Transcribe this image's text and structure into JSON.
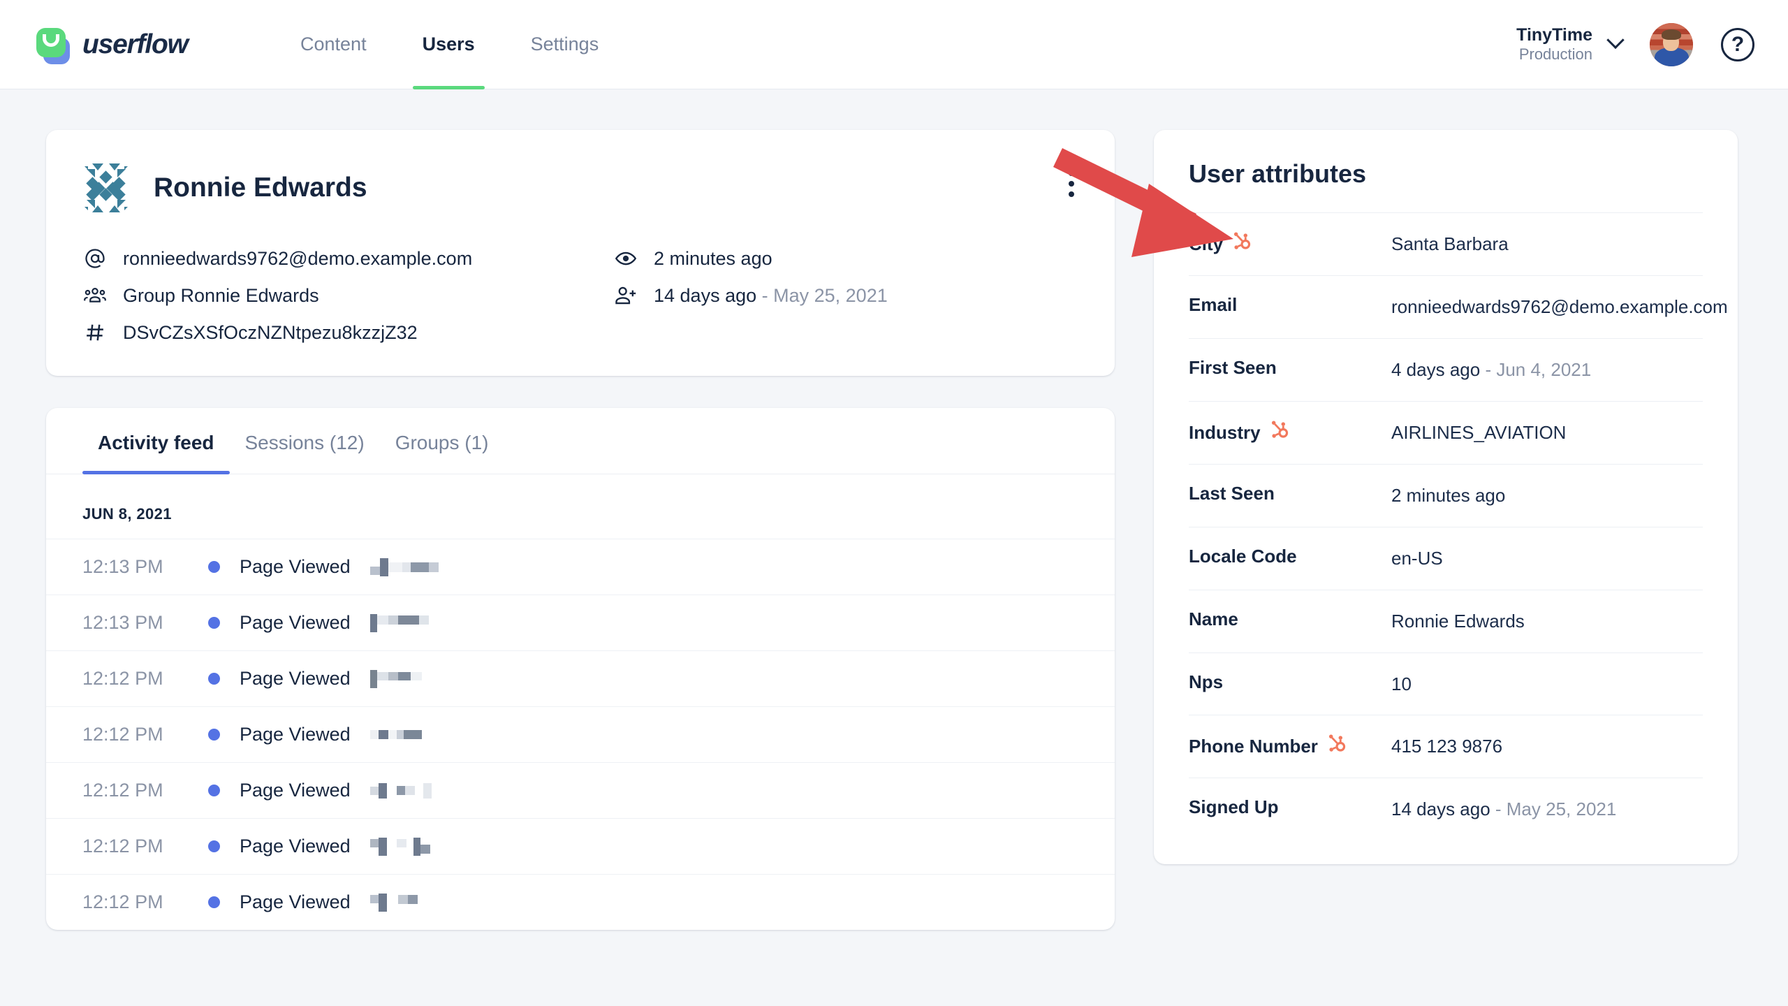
{
  "brand": {
    "wordmark": "userflow",
    "logo_icon": "userflow-logo-icon"
  },
  "nav": {
    "items": [
      {
        "label": "Content",
        "active": false
      },
      {
        "label": "Users",
        "active": true
      },
      {
        "label": "Settings",
        "active": false
      }
    ]
  },
  "header": {
    "org_name": "TinyTime",
    "org_env": "Production",
    "chevron_icon": "chevron-down-icon",
    "avatar_icon": "user-avatar",
    "help_label": "?",
    "help_icon": "help-circle-icon"
  },
  "profile": {
    "avatar_icon": "identicon-avatar",
    "name": "Ronnie Edwards",
    "menu_icon": "kebab-menu-icon",
    "rows": [
      {
        "icon": "at-sign-icon",
        "text": "ronnieedwards9762@demo.example.com",
        "suffix": ""
      },
      {
        "icon": "users-group-icon",
        "text": "Group Ronnie Edwards",
        "suffix": ""
      },
      {
        "icon": "hash-icon",
        "text": "DSvCZsXSfOczNZNtpezu8kzzjZ32",
        "suffix": ""
      },
      {
        "icon": "eye-icon",
        "text": "2 minutes ago",
        "suffix": ""
      },
      {
        "icon": "user-plus-icon",
        "text": "14 days ago",
        "suffix": " - May 25, 2021"
      }
    ]
  },
  "feed": {
    "tabs": [
      {
        "label": "Activity feed",
        "active": true
      },
      {
        "label": "Sessions (12)",
        "active": false
      },
      {
        "label": "Groups (1)",
        "active": false
      }
    ],
    "day_label": "JUN 8, 2021",
    "rows": [
      {
        "time": "12:13 PM",
        "event": "Page Viewed",
        "redacted": true
      },
      {
        "time": "12:13 PM",
        "event": "Page Viewed",
        "redacted": true
      },
      {
        "time": "12:12 PM",
        "event": "Page Viewed",
        "redacted": true
      },
      {
        "time": "12:12 PM",
        "event": "Page Viewed",
        "redacted": true
      },
      {
        "time": "12:12 PM",
        "event": "Page Viewed",
        "redacted": true
      },
      {
        "time": "12:12 PM",
        "event": "Page Viewed",
        "redacted": true
      },
      {
        "time": "12:12 PM",
        "event": "Page Viewed",
        "redacted": true
      }
    ]
  },
  "attributes": {
    "title": "User attributes",
    "rows": [
      {
        "key": "City",
        "value": "Santa Barbara",
        "source_icon": "hubspot-icon"
      },
      {
        "key": "Email",
        "value": "ronnieedwards9762@demo.example.com",
        "source_icon": ""
      },
      {
        "key": "First Seen",
        "value": "4 days ago",
        "value_muted": " - Jun 4, 2021",
        "source_icon": ""
      },
      {
        "key": "Industry",
        "value": "AIRLINES_AVIATION",
        "source_icon": "hubspot-icon"
      },
      {
        "key": "Last Seen",
        "value": "2 minutes ago",
        "source_icon": ""
      },
      {
        "key": "Locale Code",
        "value": "en-US",
        "source_icon": ""
      },
      {
        "key": "Name",
        "value": "Ronnie Edwards",
        "source_icon": ""
      },
      {
        "key": "Nps",
        "value": "10",
        "source_icon": ""
      },
      {
        "key": "Phone Number",
        "value": "415 123 9876",
        "source_icon": "hubspot-icon"
      },
      {
        "key": "Signed Up",
        "value": "14 days ago",
        "value_muted": " - May 25, 2021",
        "source_icon": ""
      }
    ]
  },
  "annotation": {
    "arrow_icon": "red-pointer-arrow",
    "color": "#e04a4a"
  },
  "colors": {
    "background": "#f4f6f9",
    "card": "#ffffff",
    "text_primary": "#17263f",
    "text_muted": "#8b94a6",
    "accent_green": "#5ad97d",
    "accent_blue": "#5472e4",
    "hubspot_orange": "#f2785c",
    "identicon_teal": "#3c7f9a",
    "annotation_red": "#e04a4a"
  }
}
